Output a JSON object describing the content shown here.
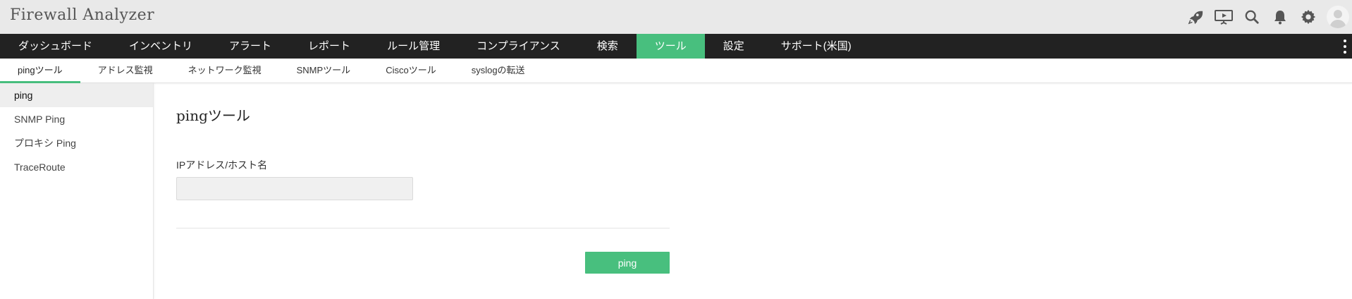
{
  "app": {
    "title": "Firewall Analyzer"
  },
  "main_nav": {
    "items": [
      {
        "label": "ダッシュボード"
      },
      {
        "label": "インベントリ"
      },
      {
        "label": "アラート"
      },
      {
        "label": "レポート"
      },
      {
        "label": "ルール管理"
      },
      {
        "label": "コンプライアンス"
      },
      {
        "label": "検索"
      },
      {
        "label": "ツール"
      },
      {
        "label": "設定"
      },
      {
        "label": "サポート(米国)"
      }
    ],
    "active": "ツール"
  },
  "sub_nav": {
    "items": [
      {
        "label": "pingツール"
      },
      {
        "label": "アドレス監視"
      },
      {
        "label": "ネットワーク監視"
      },
      {
        "label": "SNMPツール"
      },
      {
        "label": "Ciscoツール"
      },
      {
        "label": "syslogの転送"
      }
    ],
    "active": "pingツール"
  },
  "sidebar": {
    "items": [
      {
        "label": "ping"
      },
      {
        "label": "SNMP Ping"
      },
      {
        "label": "プロキシ Ping"
      },
      {
        "label": "TraceRoute"
      }
    ],
    "active": "ping"
  },
  "content": {
    "title": "pingツール",
    "field_label": "IPアドレス/ホスト名",
    "field_value": "",
    "button_label": "ping"
  },
  "colors": {
    "accent": "#48bf7e",
    "nav_bg": "#222222",
    "topbar_bg": "#e9e9e9"
  },
  "icons": [
    "rocket-icon",
    "presentation-icon",
    "search-icon",
    "bell-icon",
    "gear-icon",
    "user-avatar-icon",
    "more-vertical-icon"
  ]
}
